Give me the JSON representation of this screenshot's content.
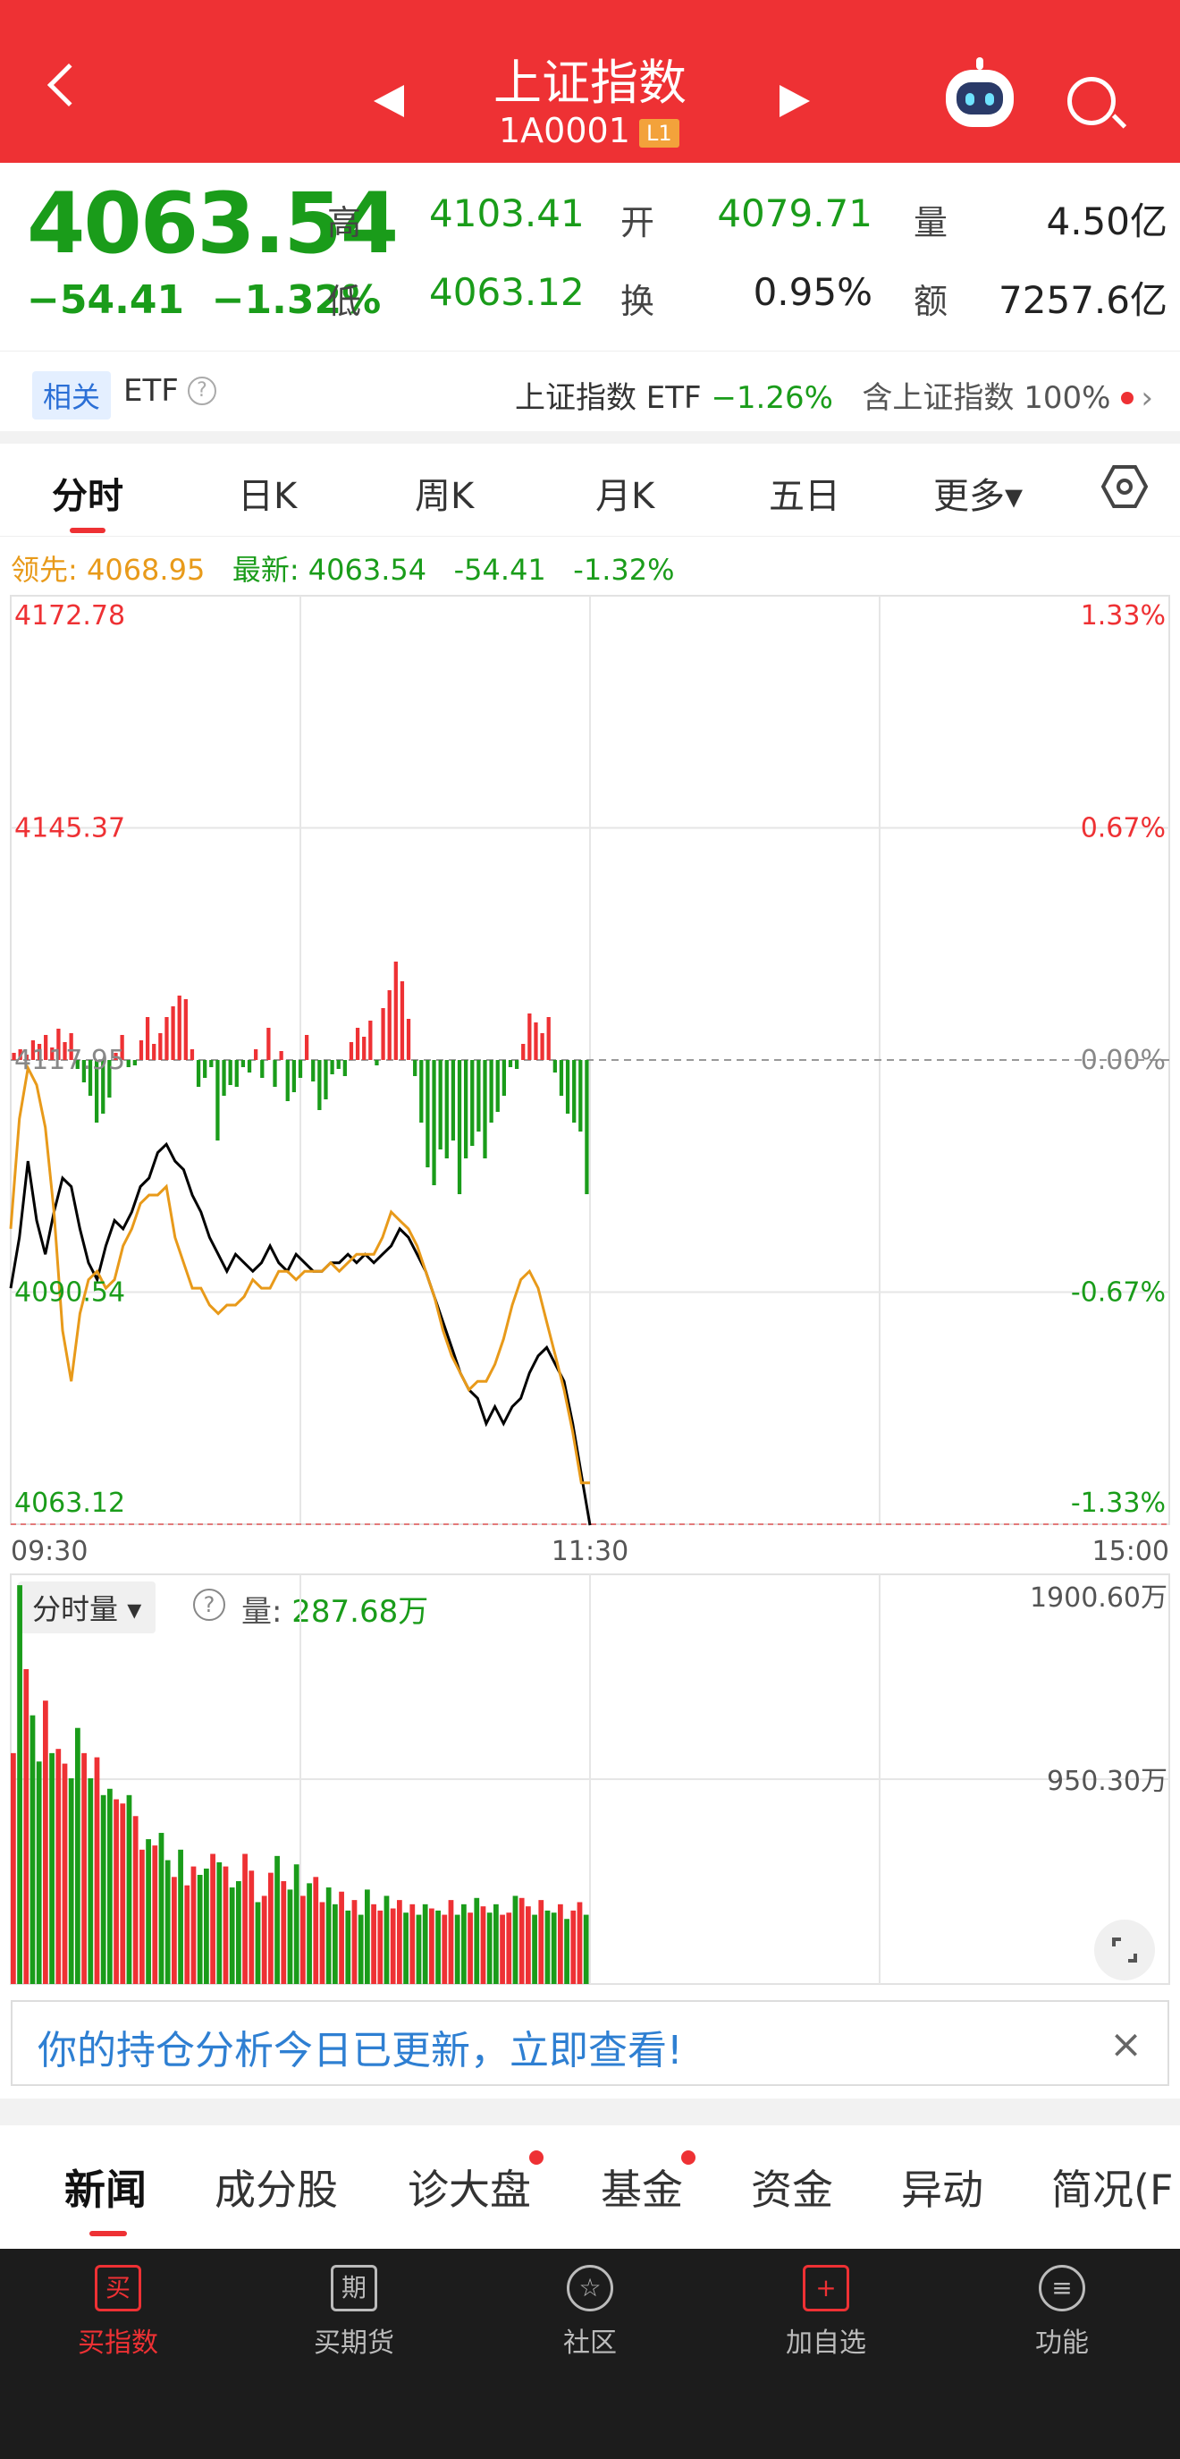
{
  "header": {
    "title": "上证指数",
    "code": "1A0001",
    "level_badge": "L1"
  },
  "quote": {
    "price": "4063.54",
    "change": "−54.41",
    "change_pct": "−1.32%",
    "high_label": "高",
    "high": "4103.41",
    "open_label": "开",
    "open": "4079.71",
    "vol_label": "量",
    "vol": "4.50亿",
    "low_label": "低",
    "low": "4063.12",
    "turn_label": "换",
    "turnover": "0.95%",
    "amt_label": "额",
    "amount": "7257.6亿"
  },
  "etf_bar": {
    "tag": "相关",
    "label": "ETF",
    "help": "?",
    "name": "上证指数 ETF",
    "pct": "−1.26%",
    "holding": "含上证指数",
    "holding_pct": "100%",
    "chevron": "›"
  },
  "chart_tabs": [
    {
      "label": "分时"
    },
    {
      "label": "日K"
    },
    {
      "label": "周K"
    },
    {
      "label": "月K"
    },
    {
      "label": "五日"
    },
    {
      "label": "更多▾"
    }
  ],
  "settings_icon": "hexagon-settings-icon",
  "legend": {
    "lead_label": "领先:",
    "lead": "4068.95",
    "last_label": "最新:",
    "last": "4063.54",
    "chg": "-54.41",
    "pct": "-1.32%"
  },
  "colors": {
    "red": "#ee3134",
    "green": "#1a9c1a",
    "orange": "#e89a1a",
    "black": "#000000"
  },
  "chart_data": [
    {
      "type": "line",
      "ylim": [
        4063.12,
        4172.78
      ],
      "y_ticks_left": [
        "4172.78",
        "4145.37",
        "4117.95",
        "4090.54",
        "4063.12"
      ],
      "y_ticks_right": [
        "1.33%",
        "0.67%",
        "0.00%",
        "-0.67%",
        "-1.33%"
      ],
      "x_ticks": [
        "09:30",
        "11:30",
        "15:00"
      ],
      "grid": true,
      "series": [
        {
          "values": [
            4091,
            4097,
            4106,
            4099,
            4095,
            4100,
            4104,
            4103,
            4098,
            4094,
            4092,
            4096,
            4099,
            4098,
            4100,
            4103,
            4104,
            4107,
            4108,
            4106,
            4105,
            4102,
            4100,
            4097,
            4095,
            4093,
            4095,
            4094,
            4093,
            4094,
            4096,
            4094,
            4093,
            4095,
            4094,
            4093,
            4093,
            4094,
            4094,
            4095,
            4094,
            4095,
            4094,
            4095,
            4096,
            4098,
            4097,
            4095,
            4093,
            4090,
            4087,
            4084,
            4081,
            4079,
            4078,
            4075,
            4077,
            4075,
            4077,
            4078,
            4081,
            4083,
            4084,
            4082,
            4080,
            4075,
            4069,
            4063
          ]
        },
        {
          "values": [
            4098,
            4111,
            4117,
            4115,
            4110,
            4100,
            4086,
            4080,
            4088,
            4092,
            4093,
            4091,
            4092,
            4096,
            4098,
            4101,
            4102,
            4102,
            4103,
            4097,
            4094,
            4091,
            4091,
            4089,
            4088,
            4089,
            4089,
            4090,
            4092,
            4091,
            4091,
            4093,
            4093,
            4092,
            4093,
            4093,
            4093,
            4094,
            4093,
            4094,
            4095,
            4095,
            4095,
            4097,
            4100,
            4099,
            4098,
            4096,
            4093,
            4090,
            4086,
            4083,
            4081,
            4079,
            4080,
            4080,
            4082,
            4085,
            4089,
            4092,
            4093,
            4091,
            4087,
            4083,
            4079,
            4074,
            4068,
            4068
          ]
        }
      ]
    },
    {
      "type": "bar",
      "ylim": [
        0,
        1900.6
      ],
      "y_ticks": [
        "1900.60万",
        "950.30万"
      ],
      "values": [
        1100,
        1900,
        1500,
        1280,
        1060,
        1350,
        1100,
        1120,
        1050,
        980,
        1220,
        1100,
        980,
        1080,
        900,
        930,
        880,
        860,
        900,
        800,
        640,
        690,
        660,
        720,
        590,
        510,
        640,
        470,
        560,
        520,
        550,
        620,
        580,
        560,
        460,
        490,
        620,
        540,
        390,
        420,
        530,
        610,
        490,
        450,
        570,
        420,
        480,
        510,
        390,
        460,
        380,
        440,
        350,
        400,
        330,
        450,
        380,
        350,
        420,
        360,
        400,
        340,
        380,
        330,
        380,
        360,
        350,
        330,
        400,
        330,
        380,
        340,
        410,
        370,
        340,
        380,
        330,
        340,
        420,
        410,
        370,
        330,
        400,
        350,
        340,
        380,
        310,
        350,
        390,
        330
      ]
    }
  ],
  "volume_header": {
    "selector": "分时量",
    "help": "?",
    "label": "量:",
    "value": "287.68万"
  },
  "banner": {
    "text": "你的持仓分析今日已更新，立即查看!",
    "close": "×"
  },
  "news_tabs": [
    {
      "label": "新闻"
    },
    {
      "label": "成分股"
    },
    {
      "label": "诊大盘"
    },
    {
      "label": "基金"
    },
    {
      "label": "资金"
    },
    {
      "label": "异动"
    },
    {
      "label": "简况(F"
    }
  ],
  "bottom_nav": [
    {
      "glyph": "买",
      "label": "买指数"
    },
    {
      "glyph": "期",
      "label": "买期货"
    },
    {
      "glyph": "☆",
      "label": "社区"
    },
    {
      "glyph": "+",
      "label": "加自选"
    },
    {
      "glyph": "≡",
      "label": "功能"
    }
  ]
}
